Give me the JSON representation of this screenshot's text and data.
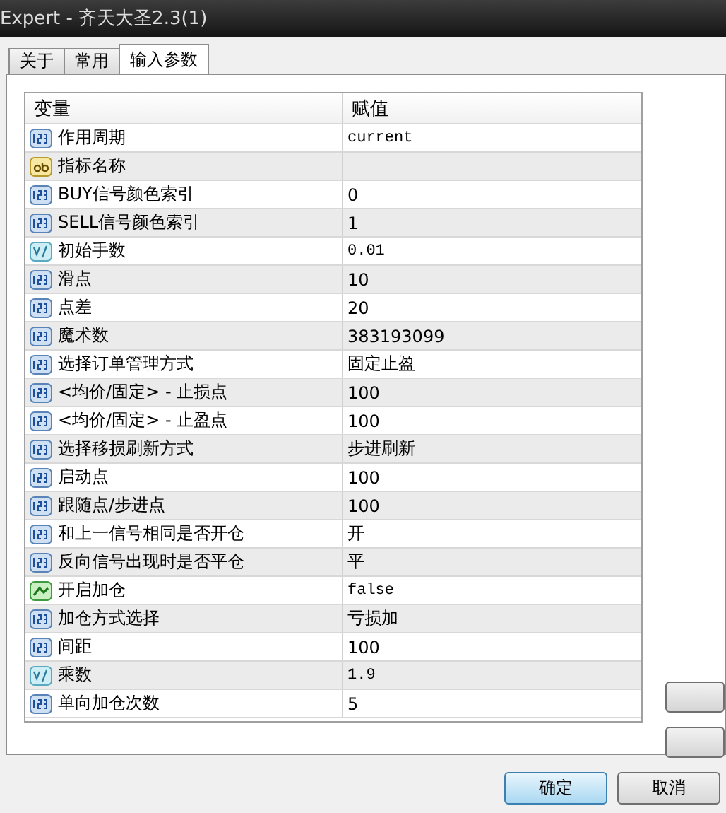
{
  "window": {
    "title": "Expert - 齐天大圣2.3(1)"
  },
  "tabs": [
    {
      "label": "关于",
      "selected": false
    },
    {
      "label": "常用",
      "selected": false
    },
    {
      "label": "输入参数",
      "selected": true
    }
  ],
  "table": {
    "columns": [
      "变量",
      "赋值"
    ],
    "rows": [
      {
        "kind": "int",
        "name": "作用周期",
        "value": "current"
      },
      {
        "kind": "string",
        "name": "指标名称"
      },
      {
        "kind": "int",
        "name": "BUY信号颜色索引",
        "value": "0"
      },
      {
        "kind": "int",
        "name": "SELL信号颜色索引",
        "value": "1"
      },
      {
        "kind": "double",
        "name": "初始手数",
        "value": "0.01"
      },
      {
        "kind": "int",
        "name": "滑点",
        "value": "10"
      },
      {
        "kind": "int",
        "name": "点差",
        "value": "20"
      },
      {
        "kind": "int",
        "name": "魔术数",
        "value": "383193099"
      },
      {
        "kind": "int",
        "name": "选择订单管理方式",
        "value": "固定止盈"
      },
      {
        "kind": "int",
        "name": "<均价/固定> - 止损点",
        "value": "100"
      },
      {
        "kind": "int",
        "name": "<均价/固定> - 止盈点",
        "value": "100"
      },
      {
        "kind": "int",
        "name": "选择移损刷新方式",
        "value": "步进刷新"
      },
      {
        "kind": "int",
        "name": "启动点",
        "value": "100"
      },
      {
        "kind": "int",
        "name": "跟随点/步进点",
        "value": "100"
      },
      {
        "kind": "int",
        "name": "和上一信号相同是否开仓",
        "value": "开"
      },
      {
        "kind": "int",
        "name": "反向信号出现时是否平仓",
        "value": "平"
      },
      {
        "kind": "bool",
        "name": "开启加仓",
        "value": "false"
      },
      {
        "kind": "int",
        "name": "加仓方式选择",
        "value": "亏损加"
      },
      {
        "kind": "int",
        "name": "间距",
        "value": "100"
      },
      {
        "kind": "double",
        "name": "乘数",
        "value": "1.9"
      },
      {
        "kind": "int",
        "name": "单向加仓次数",
        "value": "5"
      }
    ]
  },
  "buttons": [
    {
      "label": "确定",
      "kind": "default"
    },
    {
      "label": "取消",
      "kind": "normal"
    }
  ]
}
